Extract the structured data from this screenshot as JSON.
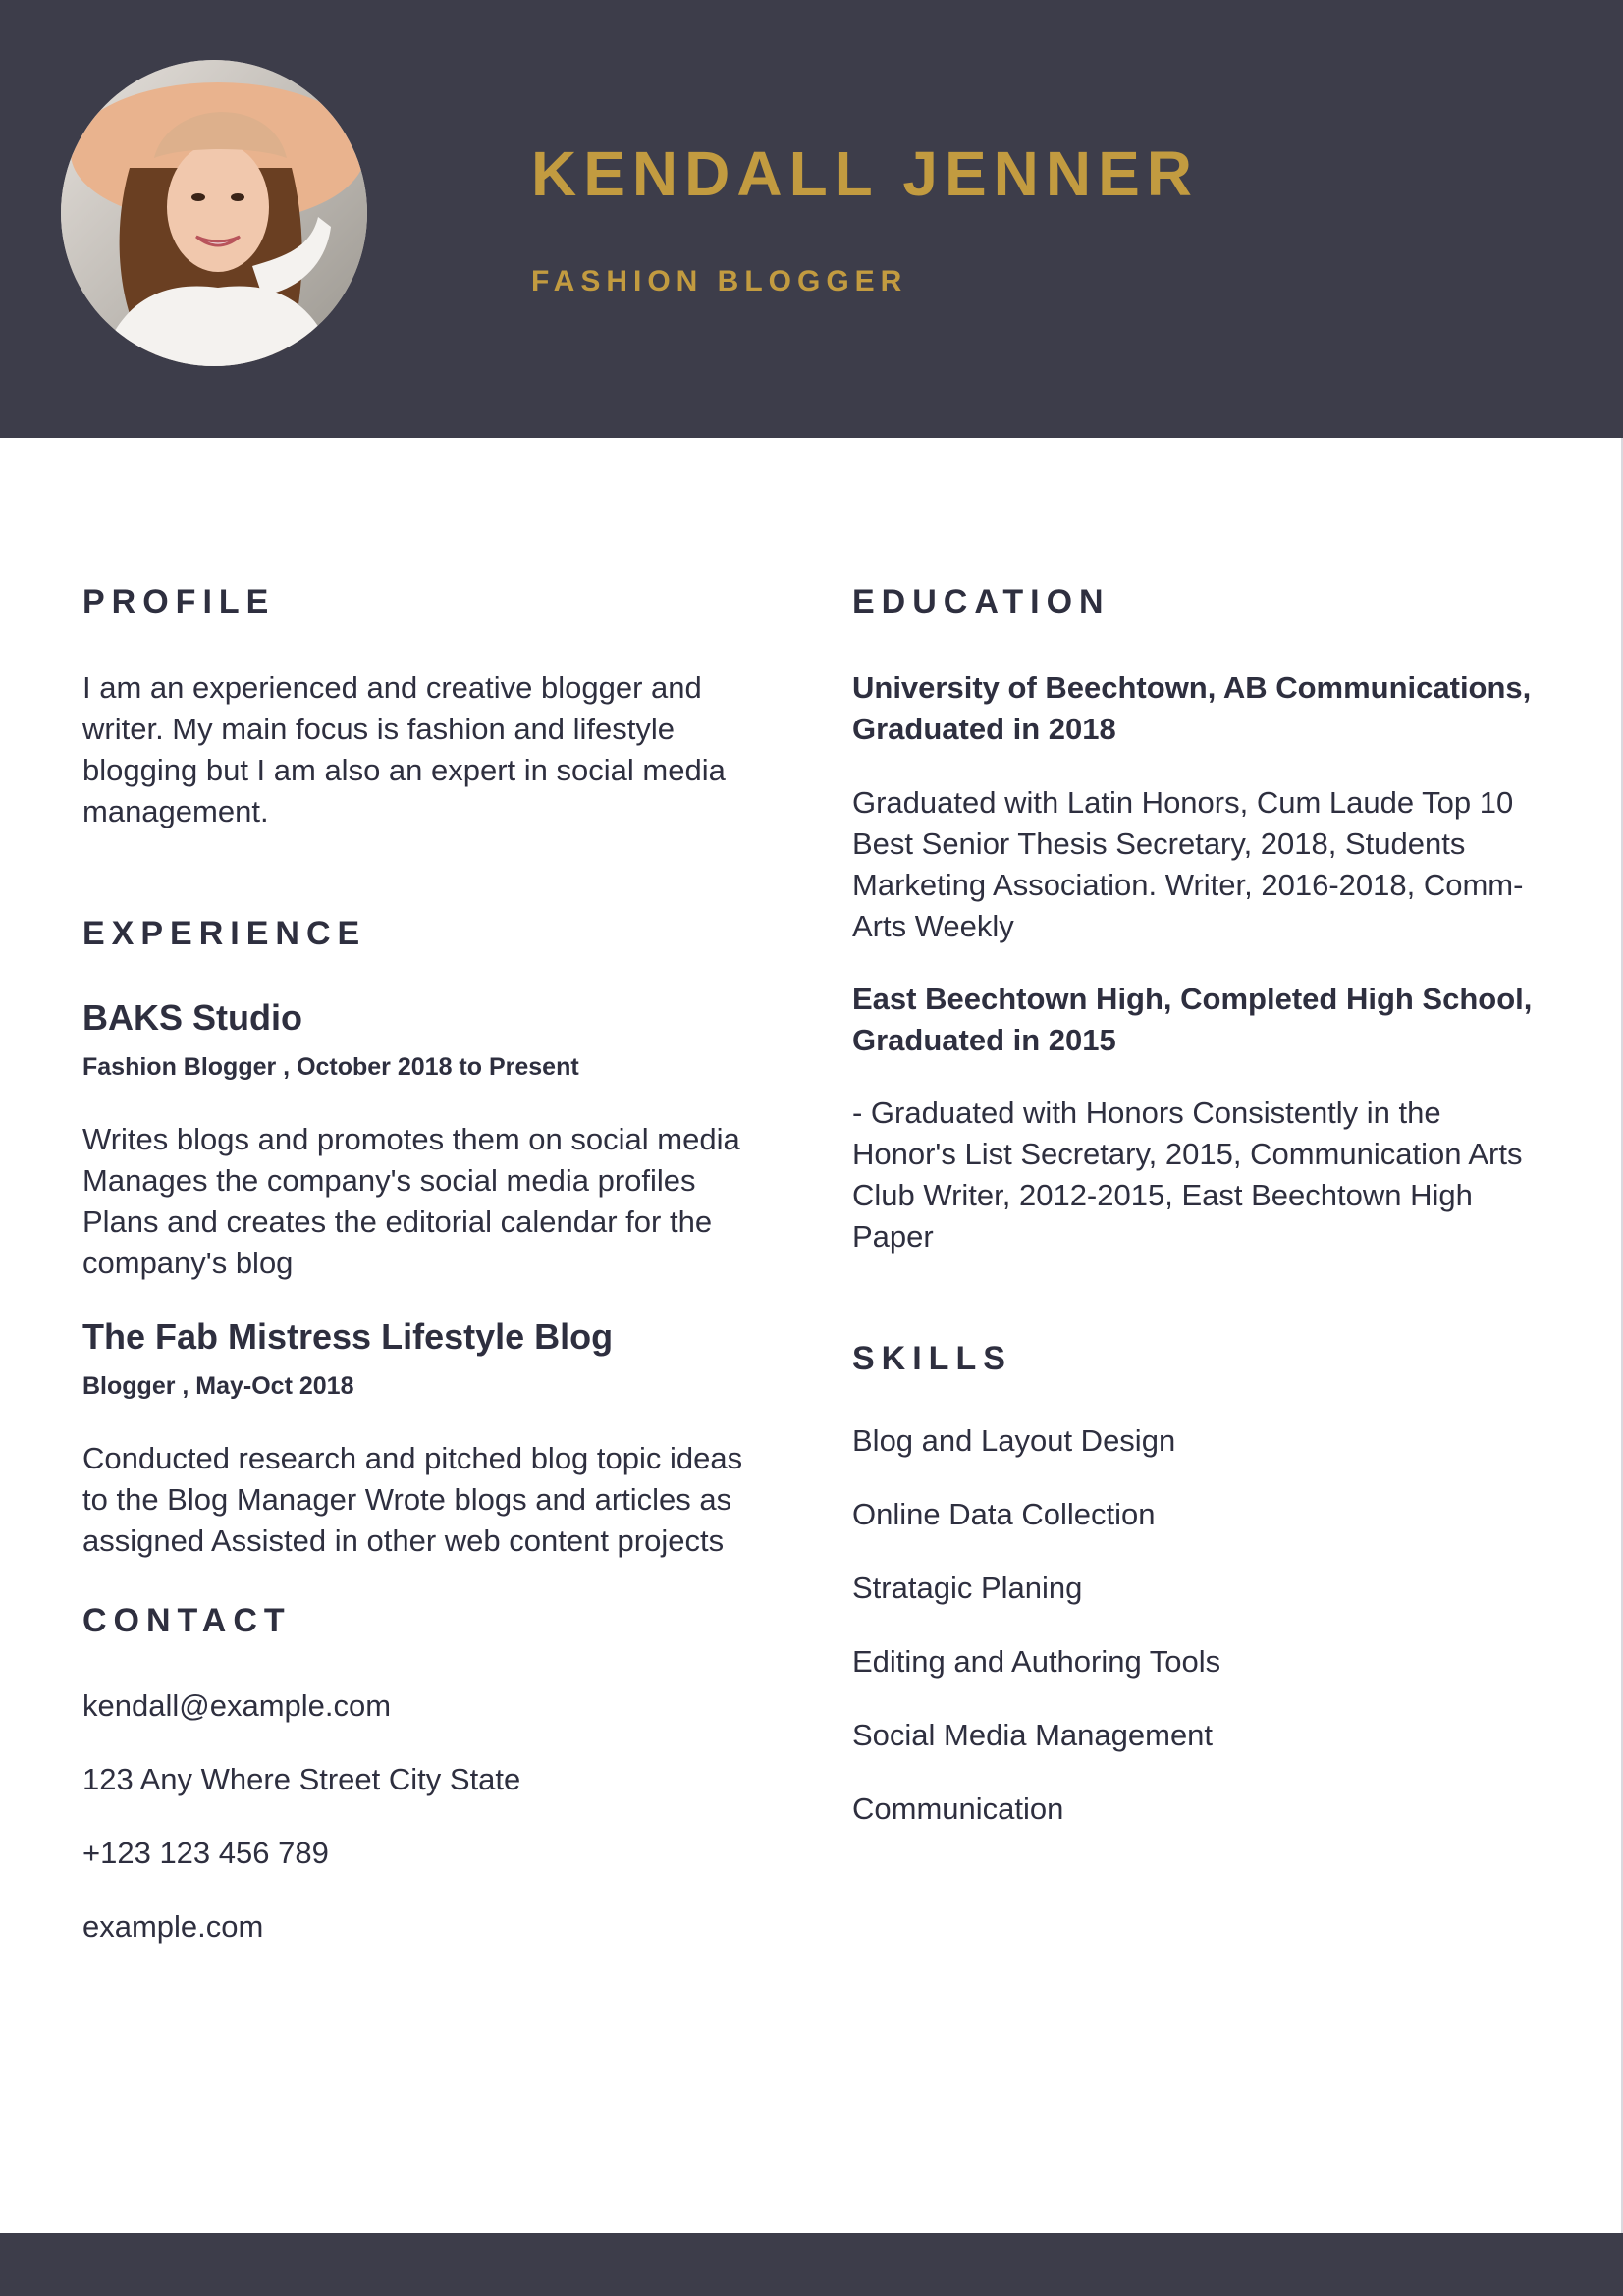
{
  "header": {
    "name": "KENDALL JENNER",
    "role": "FASHION BLOGGER"
  },
  "profile": {
    "title": "PROFILE",
    "text": "I am an experienced and creative blogger and writer. My main focus is fashion and lifestyle blogging but I am also an expert in social media management."
  },
  "experience": {
    "title": "EXPERIENCE",
    "jobs": [
      {
        "company": "BAKS Studio",
        "meta": "Fashion Blogger , October 2018 to Present",
        "description": "Writes blogs and promotes them on social media Manages the company's social media profiles Plans and creates the editorial calendar for the company's blog"
      },
      {
        "company": "The Fab Mistress Lifestyle Blog",
        "meta": "Blogger , May-Oct 2018",
        "description": "Conducted research and pitched blog topic ideas to the Blog Manager Wrote blogs and articles as assigned Assisted in other web content projects"
      }
    ]
  },
  "contact": {
    "title": "CONTACT",
    "items": [
      "kendall@example.com",
      "123 Any Where Street City State",
      "+123 123 456 789",
      "example.com"
    ]
  },
  "education": {
    "title": "EDUCATION",
    "entries": [
      {
        "heading": "University of Beechtown, AB Communications, Graduated in 2018",
        "details": "Graduated with Latin Honors, Cum Laude Top 10 Best Senior Thesis Secretary, 2018, Students Marketing Association. Writer, 2016-2018, Comm-Arts Weekly"
      },
      {
        "heading": "East Beechtown High, Completed High School, Graduated in 2015",
        "details": "- Graduated with Honors Consistently in the Honor's List Secretary, 2015, Communication Arts Club Writer, 2012-2015, East Beechtown High Paper"
      }
    ]
  },
  "skills": {
    "title": "SKILLS",
    "items": [
      "Blog and Layout Design",
      "Online Data Collection",
      "Stratagic Planing",
      "Editing and Authoring Tools",
      "Social Media Management",
      "Communication"
    ]
  },
  "colors": {
    "header_bg": "#3d3d4a",
    "accent_gold": "#c29b40",
    "text_dark": "#2e2f3f"
  }
}
